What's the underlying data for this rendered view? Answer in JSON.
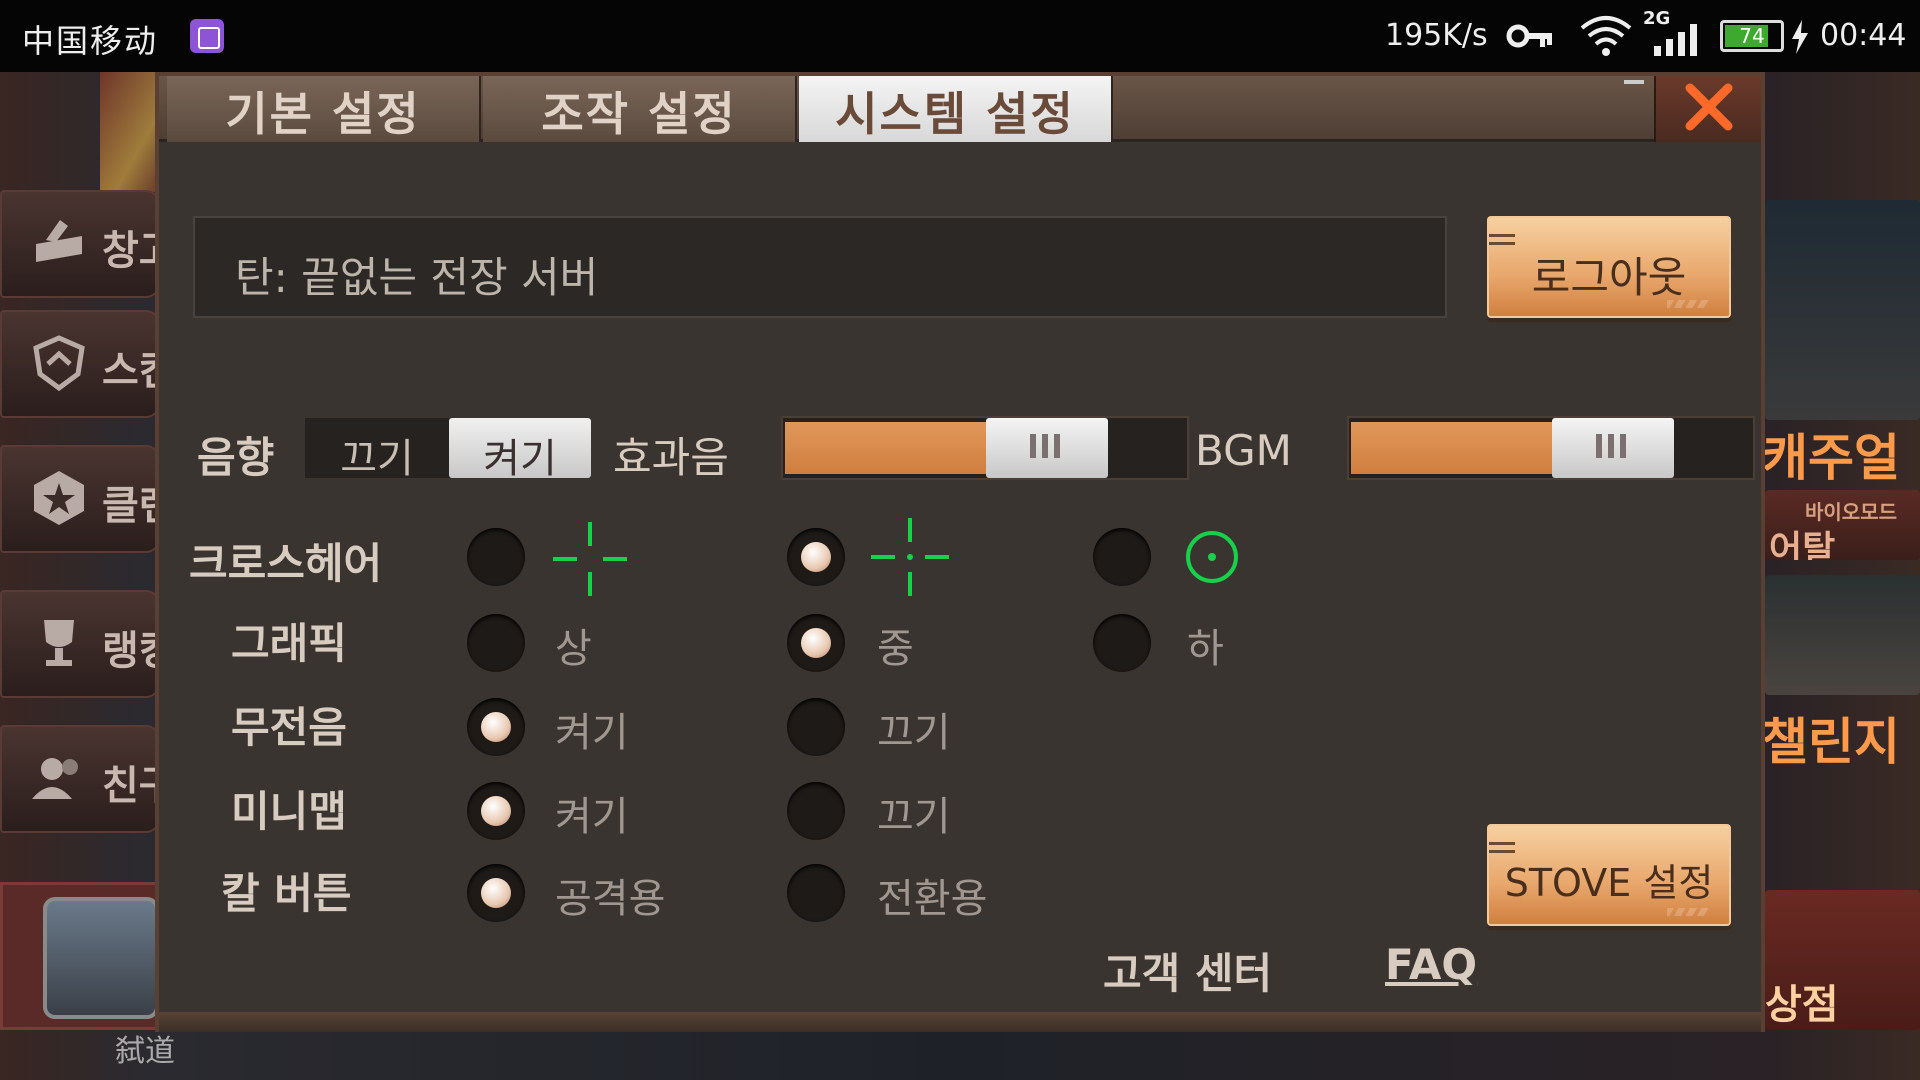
{
  "status_bar": {
    "carrier": "中国移动",
    "speed": "195K/s",
    "network": "2G",
    "battery": "74",
    "battery_level": 0.74,
    "time": "00:44"
  },
  "background": {
    "side_menu": [
      "창고",
      "스킨",
      "클랜",
      "랭킹",
      "친구"
    ],
    "right_labels": [
      "캐주얼",
      "바이오모드",
      "어탈",
      "챌린지",
      "상점"
    ],
    "bottom_name": "弑道"
  },
  "dialog": {
    "tabs": [
      "기본 설정",
      "조작 설정",
      "시스템 설정"
    ],
    "active_tab": 2,
    "server_name": "탄: 끝없는 전장 서버",
    "logout_label": "로그아웃",
    "sound": {
      "label": "음향",
      "off_label": "끄기",
      "on_label": "켜기",
      "selected": "켜기"
    },
    "effects": {
      "label": "효과음",
      "level": 0.72
    },
    "bgm": {
      "label": "BGM",
      "level": 0.72
    },
    "crosshair": {
      "label": "크로스헤어",
      "selected_index": 1,
      "crosshair_color": "#17d14a"
    },
    "graphics": {
      "label": "그래픽",
      "options": [
        "상",
        "중",
        "하"
      ],
      "selected_index": 1
    },
    "mute": {
      "label": "무전음",
      "options": [
        "켜기",
        "끄기"
      ],
      "selected_index": 0
    },
    "minimap": {
      "label": "미니맵",
      "options": [
        "켜기",
        "끄기"
      ],
      "selected_index": 0
    },
    "knife": {
      "label": "칼 버튼",
      "options": [
        "공격용",
        "전환용"
      ],
      "selected_index": 0
    },
    "stove_label": "STOVE 설정",
    "support_label": "고객 센터",
    "faq_label": "FAQ",
    "accent_color": "#d98a4a"
  }
}
